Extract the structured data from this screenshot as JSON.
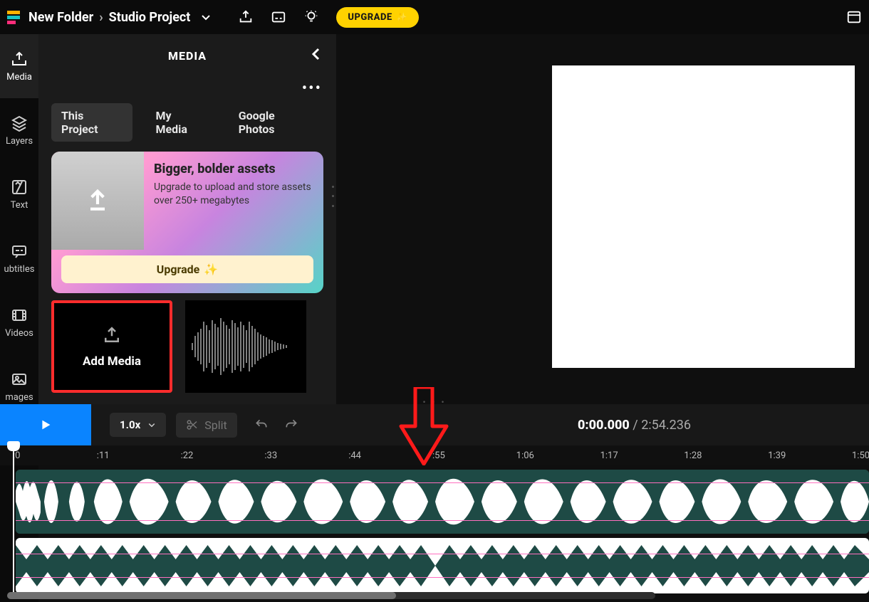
{
  "topbar": {
    "breadcrumb_folder": "New Folder",
    "breadcrumb_project": "Studio Project",
    "upgrade_label": "UPGRADE"
  },
  "rail": {
    "items": [
      {
        "label": "Media"
      },
      {
        "label": "Layers"
      },
      {
        "label": "Text"
      },
      {
        "label": "ubtitles"
      },
      {
        "label": "Videos"
      },
      {
        "label": "mages"
      }
    ]
  },
  "panel": {
    "title": "MEDIA",
    "tabs": {
      "this_project": "This Project",
      "my_media": "My Media",
      "google_photos": "Google Photos"
    },
    "promo_heading": "Bigger, bolder assets",
    "promo_body": "Upgrade to upload and store assets over 250+ megabytes",
    "promo_button": "Upgrade",
    "add_media_label": "Add Media"
  },
  "toolbar": {
    "speed_label": "1.0x",
    "split_label": "Split",
    "time_current": "0:00.000",
    "time_total": "2:54.236"
  },
  "ruler": {
    "ticks": [
      ":0",
      ":11",
      ":22",
      ":33",
      ":44",
      ":55",
      "1:06",
      "1:17",
      "1:28",
      "1:39",
      "1:50"
    ]
  }
}
